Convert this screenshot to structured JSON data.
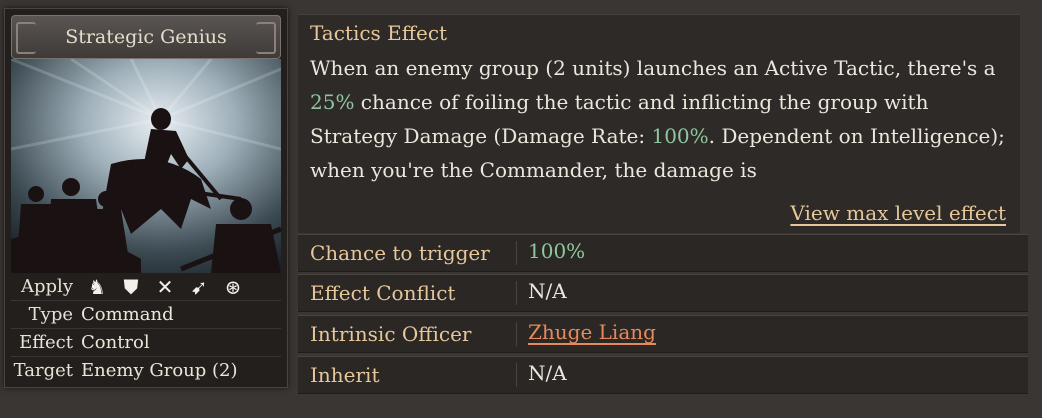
{
  "card": {
    "title": "Strategic Genius",
    "props": [
      {
        "key": "Apply",
        "value": ""
      },
      {
        "key": "Type",
        "value": "Command"
      },
      {
        "key": "Effect",
        "value": "Control"
      },
      {
        "key": "Target",
        "value": "Enemy Group (2)"
      }
    ],
    "apply_icons": [
      "cavalry-icon",
      "shield-icon",
      "crossed-bow-icon",
      "spear-icon",
      "siege-wheel-icon"
    ]
  },
  "effect": {
    "title": "Tactics Effect",
    "text_1": "When an enemy group (2 units) launches an Active Tactic, there's a ",
    "chance": "25%",
    "text_2": " chance of foiling the tactic and inflicting the group with Strategy Damage (Damage Rate: ",
    "rate": "100%",
    "text_3": ". Dependent on Intelligence); when you're the Commander, the damage is",
    "view_max": "View max level effect"
  },
  "stats": [
    {
      "key": "Chance to trigger",
      "value": "100%"
    },
    {
      "key": "Effect Conflict",
      "value": "N/A"
    },
    {
      "key": "Intrinsic Officer",
      "value": "Zhuge Liang"
    },
    {
      "key": "Inherit",
      "value": "N/A"
    }
  ],
  "colors": {
    "accent_gold": "#e6c79a",
    "highlight_green": "#8fc69e",
    "officer_link": "#e58a5c"
  }
}
